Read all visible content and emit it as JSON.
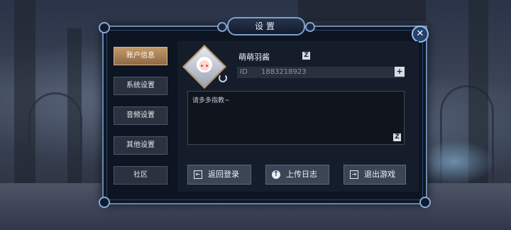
{
  "title": "设置",
  "close_symbol": "✕",
  "sidebar": {
    "items": [
      {
        "label": "账户信息",
        "active": true
      },
      {
        "label": "系统设置",
        "active": false
      },
      {
        "label": "音频设置",
        "active": false
      },
      {
        "label": "其他设置",
        "active": false
      },
      {
        "label": "社区",
        "active": false
      }
    ]
  },
  "profile": {
    "nickname": "萌萌羽酱",
    "id_label": "ID",
    "id_value": "1883218923",
    "bio": "请多多指教~",
    "edit_icon": "edit-icon",
    "copy_icon": "plus-copy-icon",
    "avatar_refresh_icon": "refresh-icon"
  },
  "actions": [
    {
      "label": "返回登录",
      "icon": "logout-icon"
    },
    {
      "label": "上传日志",
      "icon": "upload-icon"
    },
    {
      "label": "退出游戏",
      "icon": "exit-icon"
    }
  ],
  "colors": {
    "active_tab": "#c29868",
    "dialog_border": "#6b88b0",
    "panel_bg": "#161d2a"
  }
}
